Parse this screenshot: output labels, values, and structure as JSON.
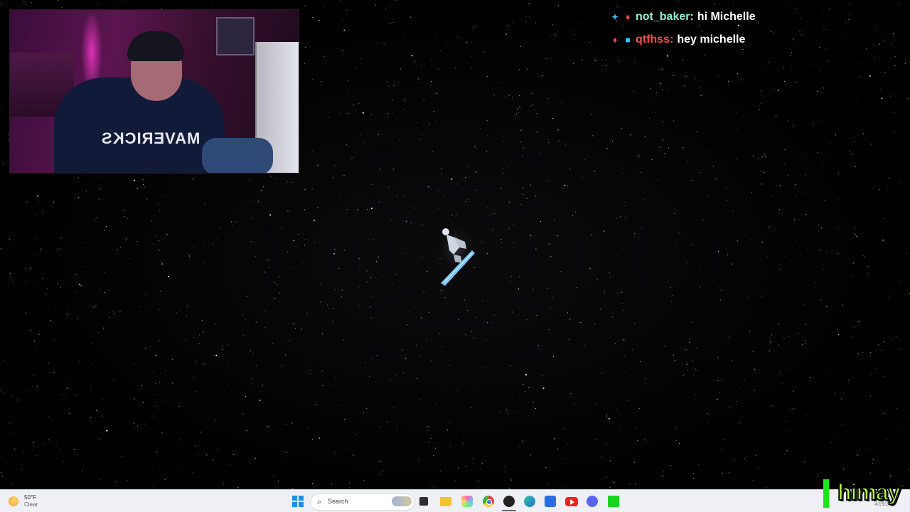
{
  "chat": {
    "messages": [
      {
        "username": "not_baker:",
        "message": "hi Michelle",
        "badges": [
          "sword-badge",
          "flame-badge"
        ],
        "username_color": "#8ef0d8"
      },
      {
        "username": "qtfhss:",
        "message": "hey michelle",
        "badges": [
          "flame-badge",
          "cube-badge"
        ],
        "username_color": "#ff4a4a"
      }
    ]
  },
  "webcam": {
    "jersey_text": "MAVERICKS"
  },
  "taskbar": {
    "weather": {
      "temp": "50°F",
      "condition": "Clear"
    },
    "search": {
      "placeholder": "Search"
    },
    "pinned_apps": [
      "windows-start-icon",
      "search-icon",
      "task-view-icon",
      "file-explorer-icon",
      "copilot-icon",
      "chrome-icon",
      "obs-icon",
      "edge-icon",
      "microsoft-store-icon",
      "youtube-icon",
      "discord-icon",
      "green-app-icon"
    ],
    "clock": "4/19/2"
  },
  "overlay": {
    "logo_text": "himay",
    "logo_color": "#b8ff3a",
    "bar_color": "#19e61d"
  },
  "colors": {
    "background": "#000000",
    "taskbar": "#eef0f5",
    "accent_windows": "#1e8fe8"
  }
}
